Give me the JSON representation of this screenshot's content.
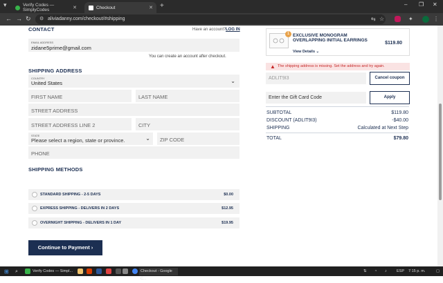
{
  "browser": {
    "tabs": [
      {
        "title": "Verify Codes — SimplyCodes",
        "active": false
      },
      {
        "title": "Checkout",
        "active": true
      }
    ],
    "url": "aliviadanny.com/checkout/#shipping"
  },
  "contact": {
    "heading": "CONTACT",
    "have_account": "Have an account?",
    "login": "LOG IN",
    "email_label": "EMAIL ADDRESS",
    "email_value": "zidane5prime@gmail.com",
    "account_note": "You can create an account after checkout."
  },
  "shipping_address": {
    "heading": "SHIPPING ADDRESS",
    "country_label": "COUNTRY",
    "country_value": "United States",
    "first_name_ph": "FIRST NAME",
    "last_name_ph": "LAST NAME",
    "street_ph": "STREET ADDRESS",
    "street2_ph": "STREET ADDRESS LINE 2",
    "city_ph": "CITY",
    "state_label": "STATE",
    "state_value": "Please select a region, state or province.",
    "zip_ph": "ZIP CODE",
    "phone_ph": "PHONE"
  },
  "shipping_methods": {
    "heading": "SHIPPING METHODS",
    "options": [
      {
        "label": "STANDARD SHIPPING - 2-5 DAYS",
        "price": "$0.00"
      },
      {
        "label": "EXPRESS SHIPPING - DELIVERS IN 2 DAYS",
        "price": "$12.95"
      },
      {
        "label": "OVERNIGHT SHIPPING - DELIVERS IN 1 DAY",
        "price": "$19.95"
      }
    ]
  },
  "continue_label": "Continue to Payment",
  "cart": {
    "qty": "1",
    "product_name": "EXCLUSIVE MONOGRAM OVERLAPPING INITIAL EARRINGS",
    "view_details": "View Details",
    "price": "$119.80"
  },
  "error_message": "The shipping address is missing. Set the address and try again.",
  "coupon": {
    "value": "ADLIT9I3",
    "cancel_label": "Cancel coupon"
  },
  "gift_card": {
    "placeholder": "Enter the Gift Card Code",
    "apply_label": "Apply"
  },
  "summary": {
    "subtotal_label": "SUBTOTAL",
    "subtotal_value": "$119.80",
    "discount_label": "DISCOUNT (ADLIT9I3)",
    "discount_value": "-$40.00",
    "shipping_label": "SHIPPING",
    "shipping_value": "Calculated at Next Step",
    "total_label": "TOTAL",
    "total_value": "$79.80"
  },
  "taskbar": {
    "items": [
      "Verify Codes — Simpl...",
      "Checkout - Google C..."
    ],
    "lang": "ESP",
    "time": "7:15 p. m."
  },
  "colors": {
    "brand": "#1c2f52",
    "error": "#c62828"
  }
}
